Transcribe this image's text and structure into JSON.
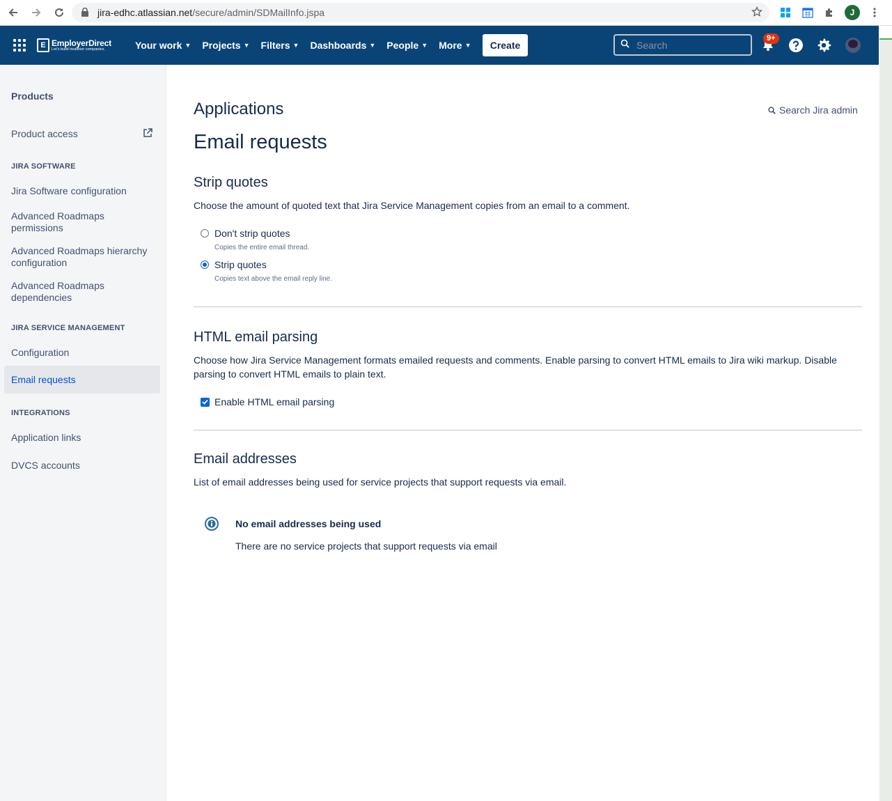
{
  "browser": {
    "url_host": "jira-edhc.atlassian.net",
    "url_path": "/secure/admin/SDMailInfo.jspa",
    "profile_initial": "J"
  },
  "topnav": {
    "logo_name": "EmployerDirect",
    "logo_tagline": "Let's build healthier companies.",
    "menu": [
      {
        "label": "Your work"
      },
      {
        "label": "Projects"
      },
      {
        "label": "Filters"
      },
      {
        "label": "Dashboards"
      },
      {
        "label": "People"
      },
      {
        "label": "More"
      }
    ],
    "create_label": "Create",
    "search_placeholder": "Search",
    "notification_badge": "9+",
    "brand_color": "#0a4477"
  },
  "sidebar": {
    "heading": "Products",
    "product_access": "Product access",
    "sections": [
      {
        "title": "JIRA SOFTWARE",
        "items": [
          "Jira Software configuration",
          "Advanced Roadmaps permissions",
          "Advanced Roadmaps hierarchy configuration",
          "Advanced Roadmaps dependencies"
        ]
      },
      {
        "title": "JIRA SERVICE MANAGEMENT",
        "items": [
          "Configuration",
          "Email requests"
        ]
      },
      {
        "title": "INTEGRATIONS",
        "items": [
          "Application links",
          "DVCS accounts"
        ]
      }
    ],
    "active_item": "Email requests"
  },
  "main": {
    "breadcrumb_title": "Applications",
    "search_admin": "Search Jira admin",
    "page_title": "Email requests",
    "strip_quotes": {
      "title": "Strip quotes",
      "description": "Choose the amount of quoted text that Jira Service Management copies from an email to a comment.",
      "options": [
        {
          "label": "Don't strip quotes",
          "hint": "Copies the entire email thread.",
          "checked": false
        },
        {
          "label": "Strip quotes",
          "hint": "Copies text above the email reply line.",
          "checked": true
        }
      ]
    },
    "html_parsing": {
      "title": "HTML email parsing",
      "description": "Choose how Jira Service Management formats emailed requests and comments. Enable parsing to convert HTML emails to Jira wiki markup. Disable parsing to convert HTML emails to plain text.",
      "checkbox_label": "Enable HTML email parsing",
      "checked": true
    },
    "email_addresses": {
      "title": "Email addresses",
      "description": "List of email addresses being used for service projects that support requests via email.",
      "info_title": "No email addresses being used",
      "info_body": "There are no service projects that support requests via email"
    }
  }
}
